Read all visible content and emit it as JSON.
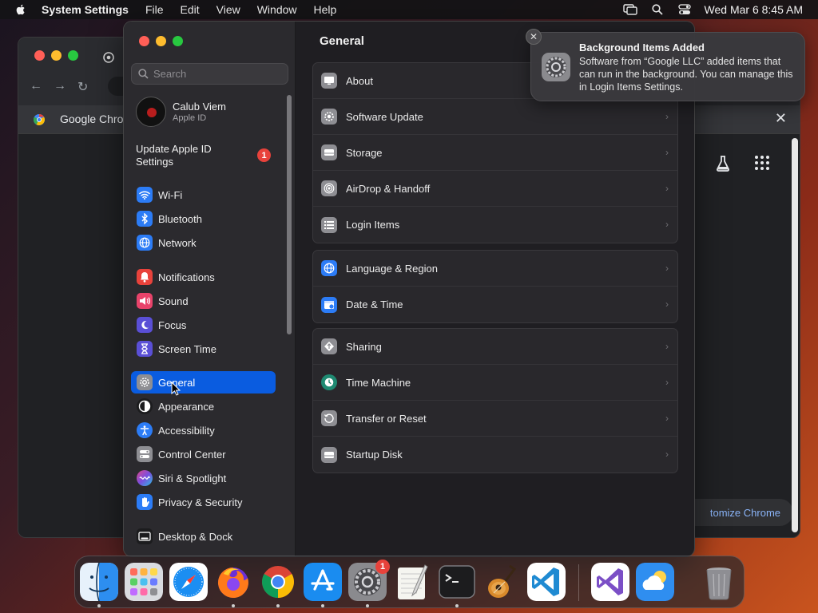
{
  "menubar": {
    "app_name": "System Settings",
    "menus": [
      "File",
      "Edit",
      "View",
      "Window",
      "Help"
    ],
    "clock": "Wed Mar 6  8:45 AM"
  },
  "chrome": {
    "tab_title": "Google Chrom",
    "customize_label": "tomize Chrome"
  },
  "sidebar": {
    "search_placeholder": "Search",
    "profile": {
      "name": "Calub Viem",
      "subtitle": "Apple ID"
    },
    "update": {
      "label": "Update Apple ID Settings",
      "badge": "1"
    },
    "items": [
      {
        "label": "Wi-Fi",
        "icon": "wifi-icon",
        "color": "#2c7cf6"
      },
      {
        "label": "Bluetooth",
        "icon": "bluetooth-icon",
        "color": "#2c7cf6"
      },
      {
        "label": "Network",
        "icon": "globe-icon",
        "color": "#2c7cf6"
      },
      {
        "label": "Notifications",
        "icon": "bell-icon",
        "color": "#e8423b"
      },
      {
        "label": "Sound",
        "icon": "speaker-icon",
        "color": "#e8436a"
      },
      {
        "label": "Focus",
        "icon": "moon-icon",
        "color": "#5a4fd6"
      },
      {
        "label": "Screen Time",
        "icon": "hourglass-icon",
        "color": "#5a4fd6"
      },
      {
        "label": "General",
        "icon": "gear-icon",
        "color": "#8e8e93"
      },
      {
        "label": "Appearance",
        "icon": "appearance-icon",
        "color": "#1c1c1e"
      },
      {
        "label": "Accessibility",
        "icon": "accessibility-icon",
        "color": "#2c7cf6"
      },
      {
        "label": "Control Center",
        "icon": "control-center-icon",
        "color": "#8e8e93"
      },
      {
        "label": "Siri & Spotlight",
        "icon": "siri-icon",
        "color": "#b04fd6"
      },
      {
        "label": "Privacy & Security",
        "icon": "hand-icon",
        "color": "#2c7cf6"
      },
      {
        "label": "Desktop & Dock",
        "icon": "dock-icon",
        "color": "#1c1c1e"
      }
    ],
    "selected": "General"
  },
  "content": {
    "title": "General",
    "groups": [
      [
        {
          "label": "About",
          "icon": "about-icon"
        },
        {
          "label": "Software Update",
          "icon": "software-update-icon"
        },
        {
          "label": "Storage",
          "icon": "storage-icon"
        },
        {
          "label": "AirDrop & Handoff",
          "icon": "airdrop-icon"
        },
        {
          "label": "Login Items",
          "icon": "login-items-icon"
        }
      ],
      [
        {
          "label": "Language & Region",
          "icon": "language-icon"
        },
        {
          "label": "Date & Time",
          "icon": "calendar-icon"
        }
      ],
      [
        {
          "label": "Sharing",
          "icon": "sharing-icon"
        },
        {
          "label": "Time Machine",
          "icon": "time-machine-icon"
        },
        {
          "label": "Transfer or Reset",
          "icon": "reset-icon"
        },
        {
          "label": "Startup Disk",
          "icon": "disk-icon"
        }
      ]
    ],
    "chevron": "›"
  },
  "notification": {
    "title": "Background Items Added",
    "body": "Software from “Google LLC” added items that can run in the background. You can manage this in Login Items Settings."
  },
  "dock": {
    "apps": [
      "Finder",
      "Launchpad",
      "Safari",
      "Firefox",
      "Google Chrome",
      "App Store",
      "System Settings",
      "TextEdit",
      "Terminal",
      "GarageBand",
      "Visual Studio Code",
      "Visual Studio",
      "Weather",
      "Trash"
    ],
    "settings_badge": "1"
  }
}
